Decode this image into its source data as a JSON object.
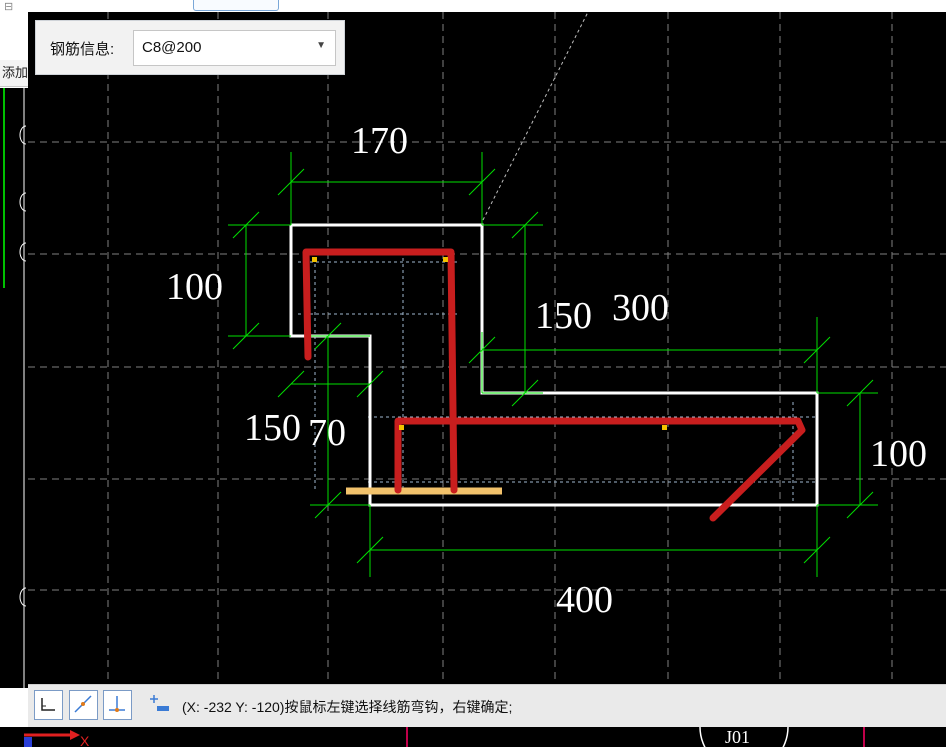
{
  "left_panel": {
    "tab_label": "添加"
  },
  "rebar_panel": {
    "label": "钢筋信息:",
    "selected_value": "C8@200"
  },
  "drawing": {
    "dimensions": [
      "170",
      "100",
      "150",
      "300",
      "150",
      "70",
      "100",
      "400"
    ],
    "colors": {
      "background": "#000000",
      "outline": "#ffffff",
      "dimension": "#00e000",
      "rebar": "#c81e1e",
      "grid": "#7f7f7f",
      "hook_marker": "#f2c26b",
      "point": "#f2c200"
    }
  },
  "status_bar": {
    "buttons": [
      "orthogonal-snap-icon",
      "diagonal-draw-icon",
      "perpendicular-icon",
      "add-segment-icon"
    ],
    "prompt": "(X: -232 Y: -120)按鼠标左键选择线筋弯钩，右键确定;"
  },
  "axis": {
    "x_label": "X"
  },
  "bottom_label": "J01"
}
